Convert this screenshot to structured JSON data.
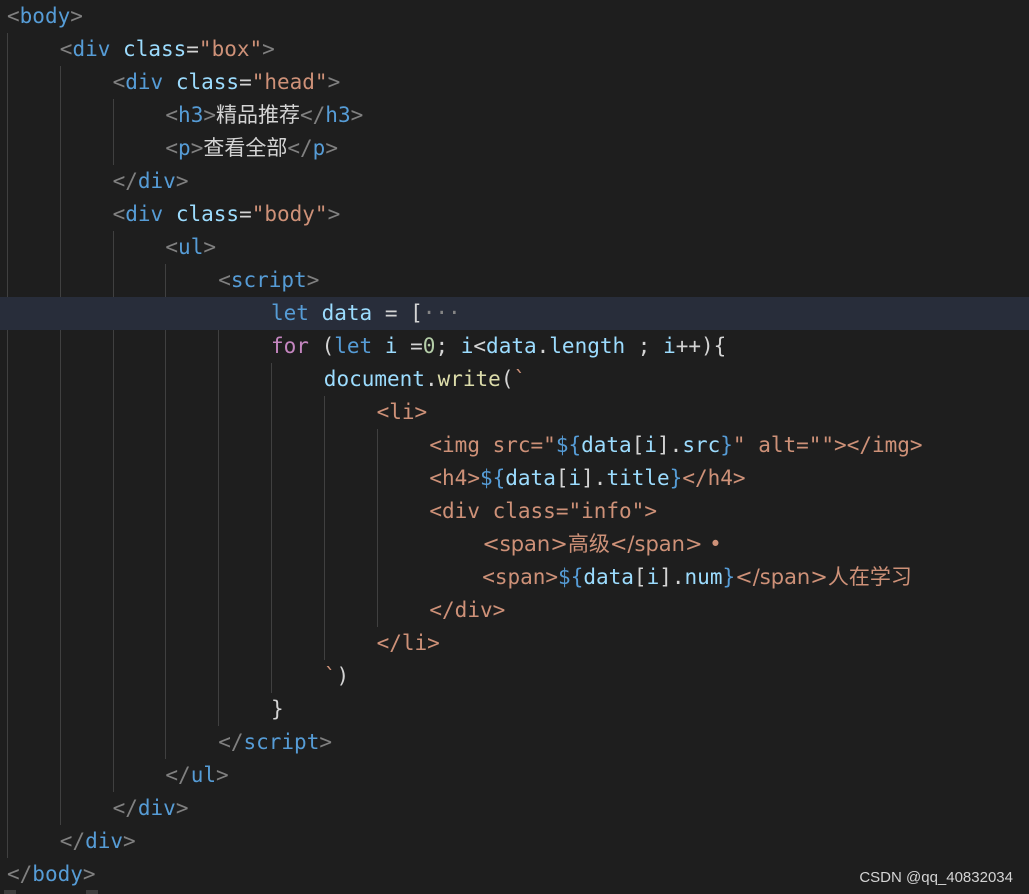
{
  "editor": {
    "lines": [
      {
        "tokens": [
          [
            "p",
            "<"
          ],
          [
            "t",
            "body"
          ],
          [
            "p",
            ">"
          ]
        ]
      },
      {
        "tokens": [
          [
            "p",
            "<"
          ],
          [
            "t",
            "div"
          ],
          [
            "w",
            " "
          ],
          [
            "a",
            "class"
          ],
          [
            "w",
            "="
          ],
          [
            "s",
            "\"box\""
          ],
          [
            "p",
            ">"
          ]
        ]
      },
      {
        "tokens": [
          [
            "p",
            "<"
          ],
          [
            "t",
            "div"
          ],
          [
            "w",
            " "
          ],
          [
            "a",
            "class"
          ],
          [
            "w",
            "="
          ],
          [
            "s",
            "\"head\""
          ],
          [
            "p",
            ">"
          ]
        ]
      },
      {
        "tokens": [
          [
            "p",
            "<"
          ],
          [
            "t",
            "h3"
          ],
          [
            "p",
            ">"
          ],
          [
            "w",
            "精品推荐"
          ],
          [
            "p",
            "</"
          ],
          [
            "t",
            "h3"
          ],
          [
            "p",
            ">"
          ]
        ]
      },
      {
        "tokens": [
          [
            "p",
            "<"
          ],
          [
            "t",
            "p"
          ],
          [
            "p",
            ">"
          ],
          [
            "w",
            "查看全部"
          ],
          [
            "p",
            "</"
          ],
          [
            "t",
            "p"
          ],
          [
            "p",
            ">"
          ]
        ]
      },
      {
        "tokens": [
          [
            "p",
            "</"
          ],
          [
            "t",
            "div"
          ],
          [
            "p",
            ">"
          ]
        ]
      },
      {
        "tokens": [
          [
            "p",
            "<"
          ],
          [
            "t",
            "div"
          ],
          [
            "w",
            " "
          ],
          [
            "a",
            "class"
          ],
          [
            "w",
            "="
          ],
          [
            "s",
            "\"body\""
          ],
          [
            "p",
            ">"
          ]
        ]
      },
      {
        "tokens": [
          [
            "p",
            "<"
          ],
          [
            "t",
            "ul"
          ],
          [
            "p",
            ">"
          ]
        ]
      },
      {
        "tokens": [
          [
            "p",
            "<"
          ],
          [
            "t",
            "script"
          ],
          [
            "p",
            ">"
          ]
        ]
      },
      {
        "tokens": [
          [
            "k",
            "let"
          ],
          [
            "w",
            " "
          ],
          [
            "v",
            "data"
          ],
          [
            "w",
            " = ["
          ],
          [
            "dim",
            "···"
          ]
        ]
      },
      {
        "tokens": [
          [
            "kf",
            "for"
          ],
          [
            "w",
            " ("
          ],
          [
            "k",
            "let"
          ],
          [
            "w",
            " "
          ],
          [
            "v",
            "i"
          ],
          [
            "w",
            " ="
          ],
          [
            "n",
            "0"
          ],
          [
            "w",
            "; "
          ],
          [
            "v",
            "i"
          ],
          [
            "w",
            "<"
          ],
          [
            "v",
            "data"
          ],
          [
            "w",
            "."
          ],
          [
            "v",
            "length"
          ],
          [
            "w",
            " ; "
          ],
          [
            "v",
            "i"
          ],
          [
            "w",
            "++){"
          ]
        ]
      },
      {
        "tokens": [
          [
            "v",
            "document"
          ],
          [
            "w",
            "."
          ],
          [
            "f",
            "write"
          ],
          [
            "w",
            "("
          ],
          [
            "s",
            "`"
          ]
        ]
      },
      {
        "tokens": [
          [
            "s",
            "<li>"
          ]
        ]
      },
      {
        "tokens": [
          [
            "s",
            "<img src=\""
          ],
          [
            "ib",
            "${"
          ],
          [
            "v",
            "data"
          ],
          [
            "w",
            "["
          ],
          [
            "v",
            "i"
          ],
          [
            "w",
            "]."
          ],
          [
            "v",
            "src"
          ],
          [
            "ib",
            "}"
          ],
          [
            "s",
            "\" alt=\"\"></img>"
          ]
        ]
      },
      {
        "tokens": [
          [
            "s",
            "<h4>"
          ],
          [
            "ib",
            "${"
          ],
          [
            "v",
            "data"
          ],
          [
            "w",
            "["
          ],
          [
            "v",
            "i"
          ],
          [
            "w",
            "]."
          ],
          [
            "v",
            "title"
          ],
          [
            "ib",
            "}"
          ],
          [
            "s",
            "</h4>"
          ]
        ]
      },
      {
        "tokens": [
          [
            "s",
            "<div class=\"info\">"
          ]
        ]
      },
      {
        "tokens": [
          [
            "s",
            "<span>高级</span> •"
          ]
        ]
      },
      {
        "tokens": [
          [
            "s",
            "<span>"
          ],
          [
            "ib",
            "${"
          ],
          [
            "v",
            "data"
          ],
          [
            "w",
            "["
          ],
          [
            "v",
            "i"
          ],
          [
            "w",
            "]."
          ],
          [
            "v",
            "num"
          ],
          [
            "ib",
            "}"
          ],
          [
            "s",
            "</span>人在学习"
          ]
        ]
      },
      {
        "tokens": [
          [
            "s",
            "</div>"
          ]
        ]
      },
      {
        "tokens": [
          [
            "s",
            "</li>"
          ]
        ]
      },
      {
        "tokens": [
          [
            "s",
            "`"
          ],
          [
            "w",
            ")"
          ]
        ]
      },
      {
        "tokens": [
          [
            "w",
            "}"
          ]
        ]
      },
      {
        "tokens": [
          [
            "p",
            "</"
          ],
          [
            "t",
            "script"
          ],
          [
            "p",
            ">"
          ]
        ]
      },
      {
        "tokens": [
          [
            "p",
            "</"
          ],
          [
            "t",
            "ul"
          ],
          [
            "p",
            ">"
          ]
        ]
      },
      {
        "tokens": [
          [
            "p",
            "</"
          ],
          [
            "t",
            "div"
          ],
          [
            "p",
            ">"
          ]
        ]
      },
      {
        "tokens": [
          [
            "p",
            "</"
          ],
          [
            "t",
            "div"
          ],
          [
            "p",
            ">"
          ]
        ]
      },
      {
        "tokens": [
          [
            "p",
            "</"
          ],
          [
            "t",
            "body"
          ],
          [
            "p",
            ">"
          ]
        ]
      }
    ]
  },
  "watermark": "CSDN @qq_40832034"
}
